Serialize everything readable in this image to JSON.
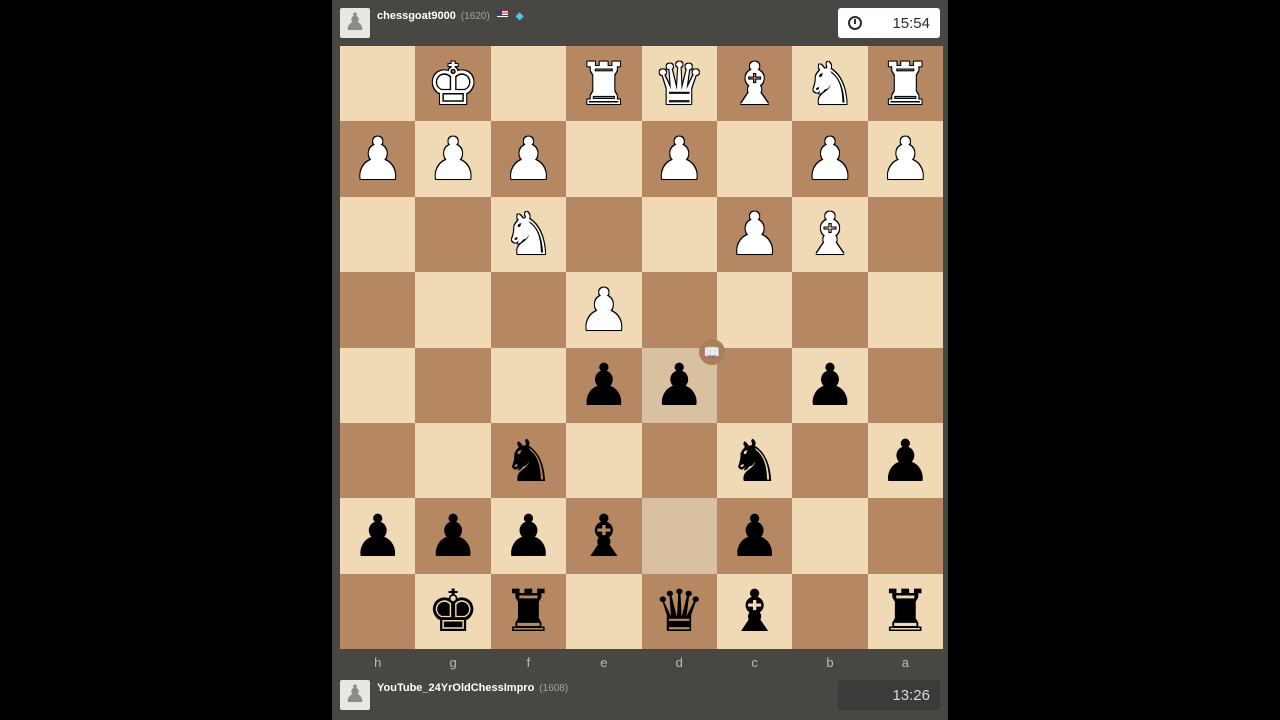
{
  "top_player": {
    "name": "chessgoat9000",
    "rating": "(1620)",
    "clock": "15:54",
    "flag": "us-flag-icon",
    "badge": "diamond-membership-icon"
  },
  "bottom_player": {
    "name": "YouTube_24YrOldChessImpro",
    "rating": "(1608)",
    "clock": "13:26"
  },
  "board": {
    "orientation": "black-at-bottom",
    "files": [
      "h",
      "g",
      "f",
      "e",
      "d",
      "c",
      "b",
      "a"
    ],
    "ranks": [
      [
        "",
        "wK",
        "",
        "wR",
        "wQ",
        "wB",
        "wN",
        "wR"
      ],
      [
        "wP",
        "wP",
        "wP",
        "",
        "wP",
        "",
        "wP",
        "wP"
      ],
      [
        "",
        "",
        "wN",
        "",
        "",
        "wP",
        "wB",
        ""
      ],
      [
        "",
        "",
        "",
        "wP",
        "",
        "",
        "",
        ""
      ],
      [
        "",
        "",
        "",
        "bP",
        "bP",
        "",
        "bP",
        ""
      ],
      [
        "",
        "",
        "bN",
        "",
        "",
        "bN",
        "",
        "bP"
      ],
      [
        "bP",
        "bP",
        "bP",
        "bB",
        "",
        "bP",
        "",
        ""
      ],
      [
        "",
        "bK",
        "bR",
        "",
        "bQ",
        "bB",
        "",
        "bR"
      ]
    ],
    "highlighted": [
      [
        4,
        4
      ],
      [
        6,
        4
      ]
    ],
    "book_marker": "book-icon"
  },
  "colors": {
    "light_square": "#f0d9b5",
    "dark_square": "#b58863",
    "highlight": "#d1b285",
    "panel_bg": "#494744"
  }
}
